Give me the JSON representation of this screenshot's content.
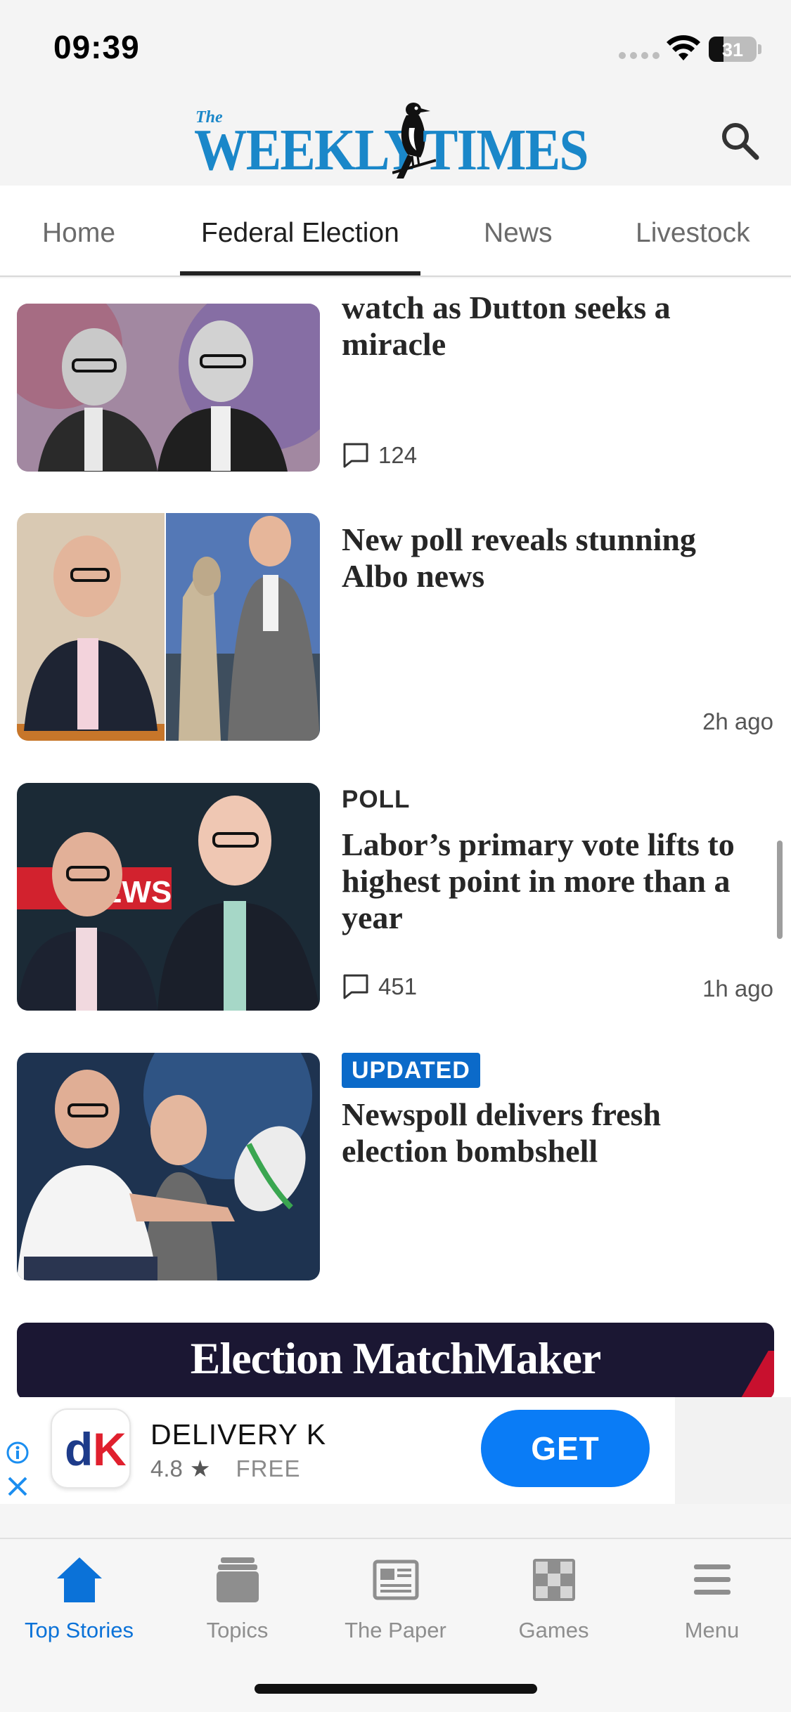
{
  "status_bar": {
    "time": "09:39",
    "battery": "31"
  },
  "header": {
    "masthead_prefix": "The",
    "masthead_word1": "WEEKLY",
    "masthead_word2": "TIMES"
  },
  "tabs": [
    {
      "label": "Home"
    },
    {
      "label": "Federal Election"
    },
    {
      "label": "News"
    },
    {
      "label": "Livestock"
    }
  ],
  "stories": [
    {
      "headline": "watch as Dutton seeks a miracle",
      "comments": "124"
    },
    {
      "headline": "New poll reveals stunning Albo news",
      "time": "2h ago"
    },
    {
      "kicker": "POLL",
      "headline": "Labor’s primary vote lifts to highest point in more than a year",
      "comments": "451",
      "time": "1h ago"
    },
    {
      "badge": "UPDATED",
      "headline": "Newspoll delivers fresh election bombshell"
    }
  ],
  "promo": {
    "title": "Election MatchMaker"
  },
  "ad": {
    "app_name": "DELIVERY K",
    "rating": "4.8",
    "price": "FREE",
    "button": "GET"
  },
  "bottom_nav": [
    {
      "label": "Top Stories",
      "icon": "house-icon",
      "active": true
    },
    {
      "label": "Topics",
      "icon": "stack-icon"
    },
    {
      "label": "The Paper",
      "icon": "newspaper-icon"
    },
    {
      "label": "Games",
      "icon": "checker-icon"
    },
    {
      "label": "Menu",
      "icon": "hamburger-icon"
    }
  ],
  "colors": {
    "brand_blue": "#1a87c9",
    "accent_blue": "#0b72d8",
    "badge_blue": "#0b6ac9",
    "get_button": "#0a7cf6"
  }
}
